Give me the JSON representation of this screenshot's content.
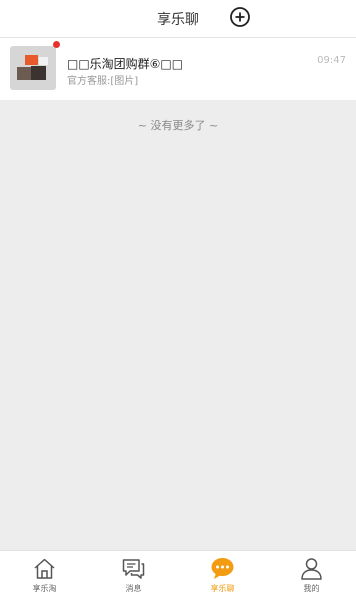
{
  "header": {
    "title": "享乐聊",
    "add_icon": "plus-circle-icon"
  },
  "chat_list": [
    {
      "name": "□□乐淘团购群⑥□□",
      "preview": "官方客服:[图片]",
      "time": "09:47",
      "unread": true
    }
  ],
  "footer_note": "~ 没有更多了 ~",
  "tabs": [
    {
      "label": "享乐淘",
      "icon": "home-icon",
      "active": false
    },
    {
      "label": "消息",
      "icon": "message-icon",
      "active": false
    },
    {
      "label": "享乐聊",
      "icon": "chat-bubble-icon",
      "active": true
    },
    {
      "label": "我的",
      "icon": "user-icon",
      "active": false
    }
  ],
  "colors": {
    "accent": "#f39c12",
    "unread_dot": "#e5322d",
    "background": "#ededed"
  }
}
